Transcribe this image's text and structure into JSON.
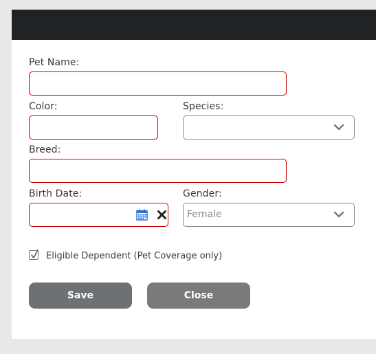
{
  "form": {
    "pet_name_label": "Pet Name:",
    "color_label": "Color:",
    "species_label": "Species:",
    "species_value": "",
    "breed_label": "Breed:",
    "birth_date_label": "Birth Date:",
    "gender_label": "Gender:",
    "gender_value": "Female",
    "eligible_label": "Eligible Dependent (Pet Coverage only)",
    "eligible_checked": true
  },
  "buttons": {
    "save": "Save",
    "close": "Close"
  },
  "colors": {
    "header": "#202326",
    "required_border": "#cc0000",
    "button": "#6d7074",
    "calendar_icon": "#2a6fdb"
  },
  "icons": [
    "calendar-icon",
    "clear-icon",
    "chevron-down-icon",
    "checkmark-icon"
  ]
}
